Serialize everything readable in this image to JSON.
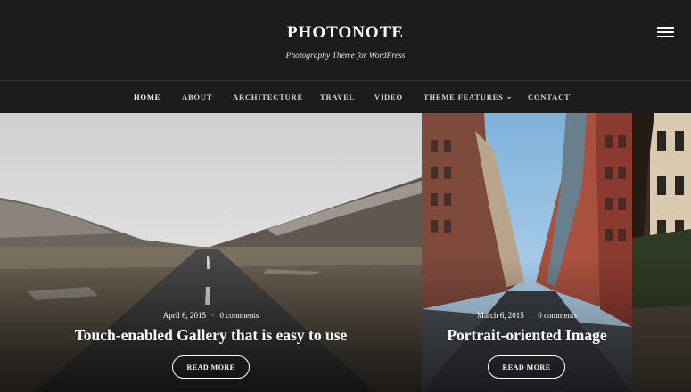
{
  "site": {
    "title": "PHOTONOTE",
    "tagline": "Photography Theme for WordPress"
  },
  "header": {
    "menu_icon": "hamburger-menu-icon"
  },
  "nav": {
    "items": [
      {
        "label": "HOME",
        "active": true
      },
      {
        "label": "ABOUT"
      },
      {
        "label": "ARCHITECTURE"
      },
      {
        "label": "TRAVEL"
      },
      {
        "label": "VIDEO"
      },
      {
        "label": "THEME FEATURES",
        "has_dropdown": true,
        "icon": "chevron-down-icon"
      },
      {
        "label": "CONTACT"
      }
    ]
  },
  "slides": [
    {
      "date": "April 6, 2015",
      "comments": "0 comments",
      "title": "Touch-enabled Gallery that is easy to use",
      "button": "READ MORE"
    },
    {
      "date": "March 6, 2015",
      "comments": "0 comments",
      "title": "Portrait-oriented Image",
      "button": "READ MORE"
    }
  ],
  "colors": {
    "header_bg": "#1c1c1c",
    "text": "#ffffff"
  }
}
